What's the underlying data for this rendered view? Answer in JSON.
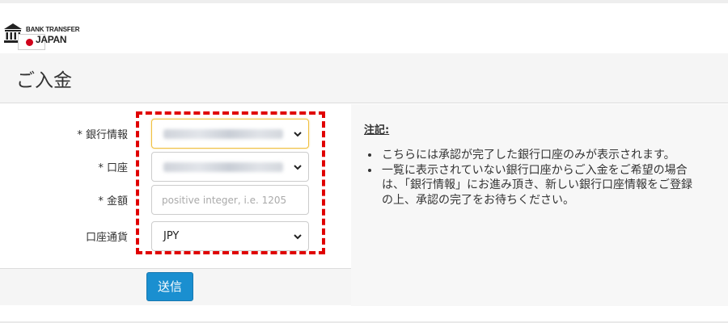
{
  "logo": {
    "line1": "BANK TRANSFER",
    "line2": "JAPAN",
    "icons": [
      "bank-building-icon",
      "japan-flag-icon"
    ]
  },
  "page": {
    "title": "ご入金"
  },
  "form": {
    "fields": [
      {
        "required_mark": "*",
        "label": "銀行情報",
        "type": "select",
        "value_redacted": true
      },
      {
        "required_mark": "*",
        "label": "口座",
        "type": "select",
        "value_redacted": true
      },
      {
        "required_mark": "*",
        "label": "金額",
        "type": "text",
        "value": "",
        "placeholder": "positive integer, i.e. 1205"
      },
      {
        "required_mark": "",
        "label": "口座通貨",
        "type": "select",
        "value": "JPY"
      }
    ],
    "submit_label": "送信"
  },
  "notes": {
    "title": "注記:",
    "items": [
      "こちらには承認が完了した銀行口座のみが表示されます。",
      "一覧に表示されていない銀行口座からご入金をご希望の場合は、「銀行情報」にお進み頂き、新しい銀行口座情報をご登録の上、承認の完了をお待ちください。"
    ]
  },
  "colors": {
    "accent_button": "#1a8fd0",
    "highlight_box": "#e00000",
    "focus_border": "#f0c040"
  }
}
